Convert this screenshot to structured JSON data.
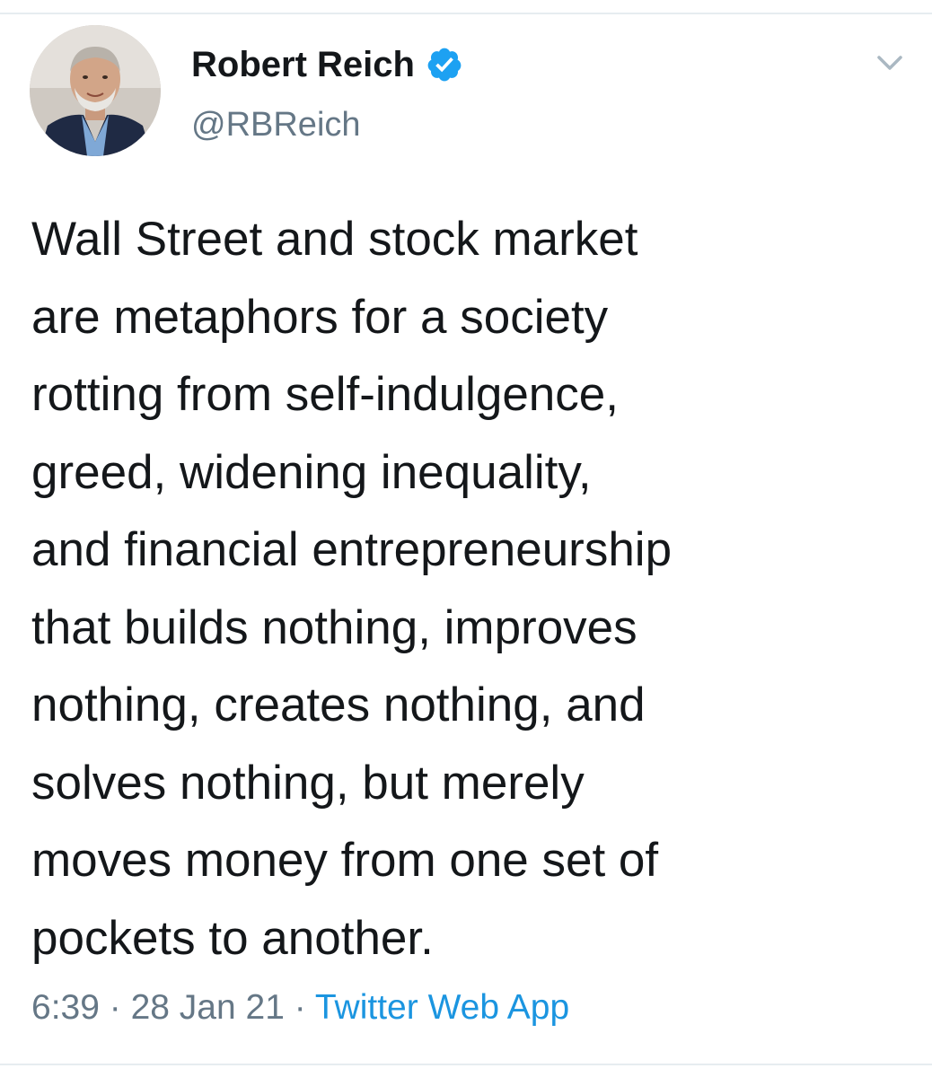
{
  "tweet": {
    "author": {
      "display_name": "Robert Reich",
      "handle": "@RBReich",
      "verified": true,
      "avatar_icon": "avatar-photo"
    },
    "text_lines": [
      "Wall Street and stock market",
      "are metaphors for a society",
      "rotting from self-indulgence,",
      "greed, widening inequality,",
      "and financial entrepreneurship",
      "that builds nothing, improves",
      "nothing, creates nothing, and",
      "solves nothing, but merely",
      "moves money from one set of",
      "pockets to another."
    ],
    "time": "6:39",
    "separator": "·",
    "date": "28 Jan 21",
    "source": "Twitter Web App",
    "menu_icon": "chevron-down-icon"
  },
  "colors": {
    "primary_text": "#14171a",
    "secondary_text": "#657786",
    "link": "#1b95e0",
    "verified_badge": "#1da1f2",
    "divider": "#e6ecf0"
  }
}
